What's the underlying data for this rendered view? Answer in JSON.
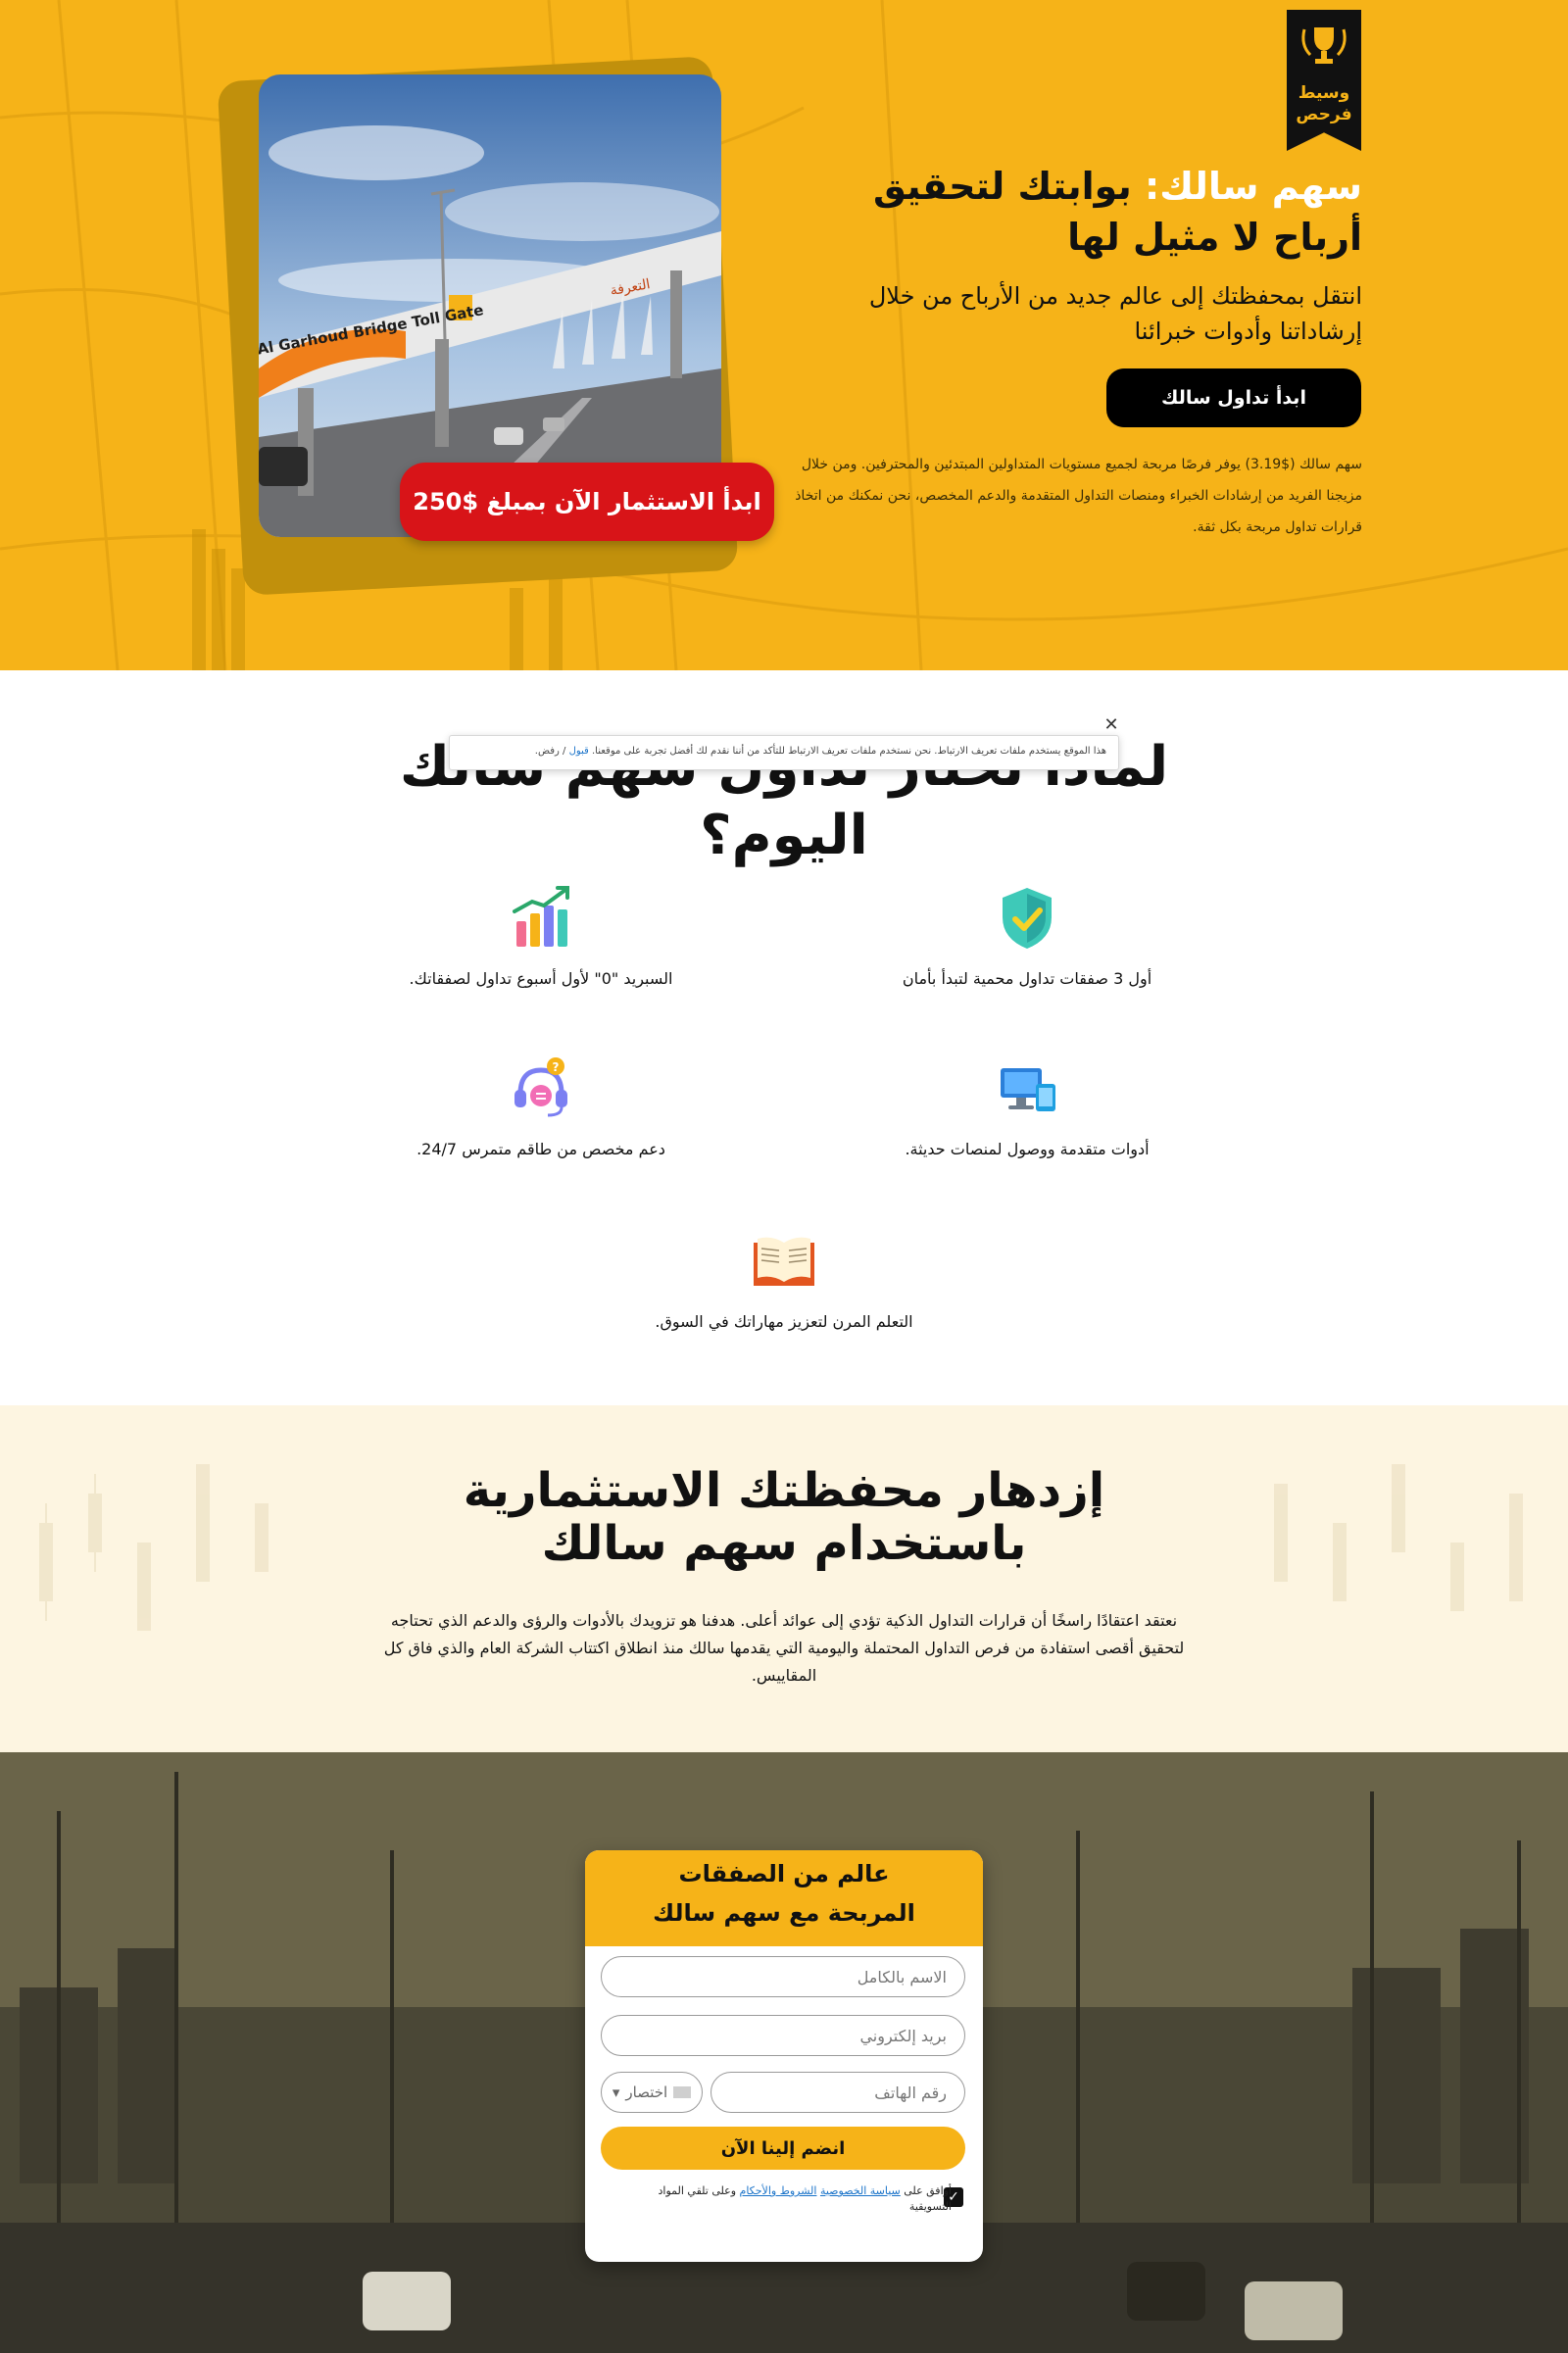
{
  "hero": {
    "badge_line1": "وسيط",
    "badge_line2": "فرحص",
    "title_highlight": "سهم سالك:",
    "title_rest": " بوابتك لتحقيق أرباح لا مثيل لها",
    "subtitle": "انتقل بمحفظتك إلى عالم جديد من الأرباح من خلال إرشاداتنا وأدوات خبرائنا",
    "start_button": "ابدأ تداول سالك",
    "description": "سهم سالك ($3.19) يوفر فرصًا مربحة لجميع مستويات المتداولين المبتدئين والمحترفين. ومن خلال مزيجنا الفريد من إرشادات الخبراء ومنصات التداول المتقدمة والدعم المخصص، نحن نمكنك من اتخاذ قرارات تداول مربحة بكل ثقة.",
    "invest_button": "ابدأ الاستثمار الآن بمبلغ $250",
    "photo_sign_en": "Al Garhoud Bridge Toll Gate",
    "photo_sign_ar": "التعرفة",
    "photo_sign_brand": "salik"
  },
  "cookie": {
    "text": "هذا الموقع يستخدم ملفات تعريف الارتباط. نحن نستخدم ملفات تعريف الارتباط للتأكد من أننا نقدم لك أفضل تجربة على موقعنا.",
    "accept": "قبول",
    "separator": " / ",
    "reject": "رفض."
  },
  "why": {
    "title": "لماذا تختار تداول سهم سالك اليوم؟",
    "features": [
      {
        "icon": "shield-check-icon",
        "text": "أول 3 صفقات تداول محمية لتبدأ بأمان"
      },
      {
        "icon": "bar-chart-icon",
        "text": "السبريد \"0\" لأول أسبوع تداول لصفقاتك."
      },
      {
        "icon": "devices-icon",
        "text": "أدوات متقدمة ووصول لمنصات حديثة."
      },
      {
        "icon": "headset-support-icon",
        "text": "دعم مخصص من طاقم متمرس 24/7."
      },
      {
        "icon": "open-book-icon",
        "text": "التعلم المرن لتعزيز مهاراتك في السوق."
      }
    ]
  },
  "grow": {
    "title_line1": "إزدهار محفظتك الاستثمارية",
    "title_line2": "باستخدام سهم سالك",
    "text": "نعتقد اعتقادًا راسخًا أن قرارات التداول الذكية تؤدي إلى عوائد أعلى. هدفنا هو تزويدك بالأدوات والرؤى والدعم الذي تحتاجه لتحقيق أقصى استفادة من فرص التداول المحتملة واليومية التي يقدمها سالك منذ انطلاق اكتتاب الشركة العام والذي فاق كل المقاييس."
  },
  "form": {
    "title_line1": "عالم من الصفقات",
    "title_line2": "المربحة مع سهم سالك",
    "name_placeholder": "الاسم بالكامل",
    "email_placeholder": "بريد إلكتروني",
    "phone_placeholder": "رقم الهاتف",
    "code_placeholder": "اختصار",
    "submit": "انضم إلينا الآن",
    "consent_prefix": "أوافق على ",
    "privacy_link": "سياسة الخصوصية",
    "consent_mid": " ",
    "terms_link": "الشروط والأحكام",
    "consent_suffix": " وعلى تلقي المواد التسويقية"
  },
  "colors": {
    "brand_yellow": "#f6b318",
    "invest_red": "#d81418",
    "cream": "#fdf5e1",
    "dark": "#111111"
  }
}
